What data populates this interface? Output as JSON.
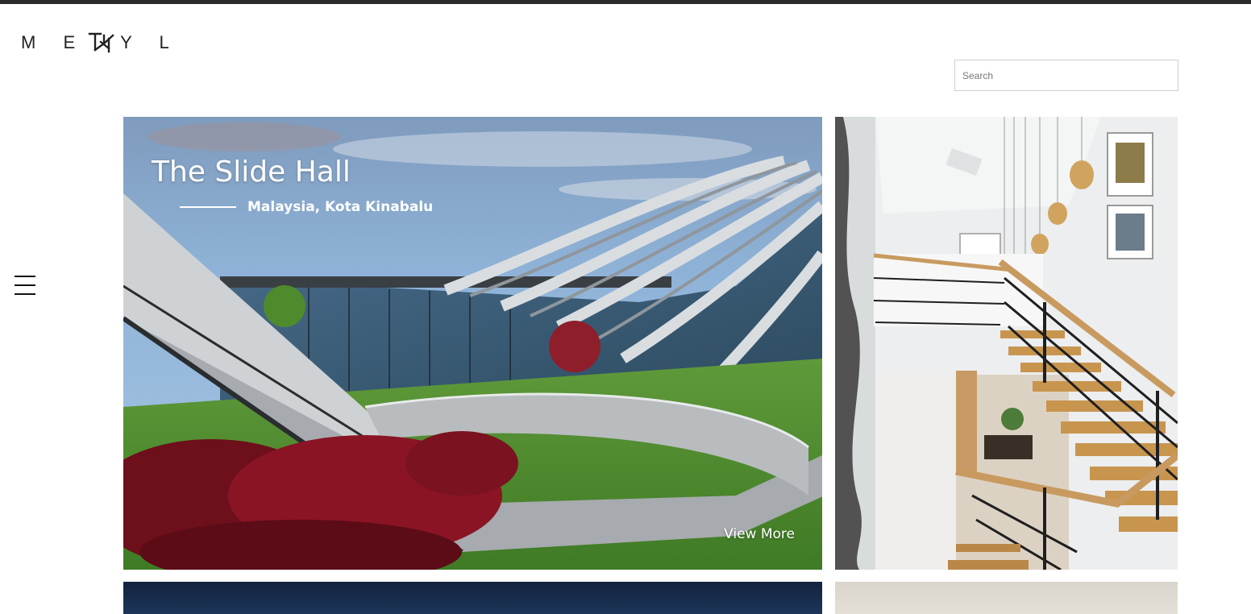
{
  "header": {
    "logo_letters": [
      "M",
      "E",
      "T",
      "H",
      "Y",
      "L"
    ],
    "logo_left": "M E",
    "logo_right": "Y L",
    "search_placeholder": "Search"
  },
  "nav": {
    "menu_icon": "hamburger-menu-icon"
  },
  "featured": [
    {
      "title": "The Slide Hall",
      "location": "Malaysia, Kota Kinabalu",
      "cta": "View More"
    }
  ],
  "colors": {
    "topbar": "#2b2b2b",
    "text_on_image": "#ffffff",
    "search_border": "#cfcfcf"
  }
}
